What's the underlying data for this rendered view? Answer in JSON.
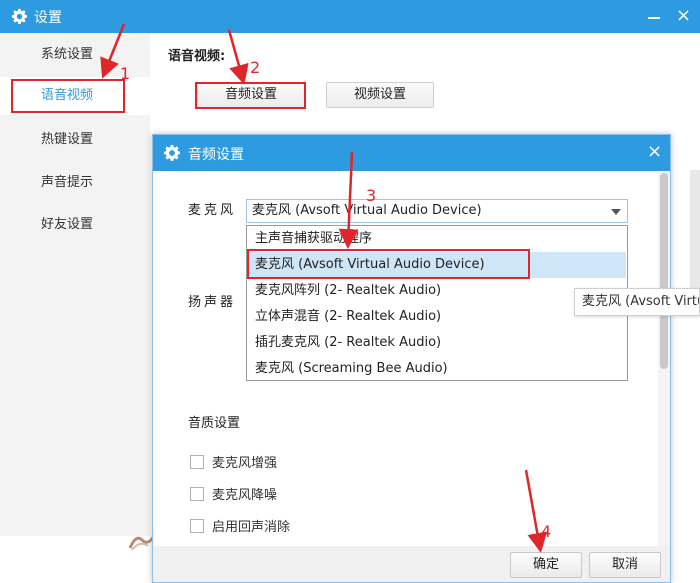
{
  "window": {
    "title": "设置",
    "close_glyph": "×"
  },
  "sidebar": {
    "items": [
      {
        "label": "系统设置"
      },
      {
        "label": "语音视频"
      },
      {
        "label": "热键设置"
      },
      {
        "label": "声音提示"
      },
      {
        "label": "好友设置"
      }
    ],
    "active_index": 1
  },
  "main": {
    "section_title": "语音视频:",
    "tabs": [
      {
        "label": "音频设置"
      },
      {
        "label": "视频设置"
      }
    ]
  },
  "dialog": {
    "title": "音频设置",
    "close_glyph": "×",
    "microphone_label": "麦克风",
    "speaker_label": "扬声器",
    "microphone_selected": "麦克风 (Avsoft Virtual Audio Device)",
    "microphone_options": [
      "主声音捕获驱动程序",
      "麦克风 (Avsoft Virtual Audio Device)",
      "麦克风阵列 (2- Realtek Audio)",
      "立体声混音 (2- Realtek Audio)",
      "插孔麦克风 (2- Realtek Audio)",
      "麦克风 (Screaming Bee Audio)"
    ],
    "hovered_option_index": 1,
    "quality_title": "音质设置",
    "quality_options": [
      {
        "label": "麦克风增强",
        "checked": false
      },
      {
        "label": "麦克风降噪",
        "checked": false
      },
      {
        "label": "启用回声消除",
        "checked": false
      }
    ],
    "ok_label": "确定",
    "cancel_label": "取消"
  },
  "tooltip": {
    "text": "麦克风 (Avsoft Virtual Audio Device)"
  },
  "annotations": {
    "steps": [
      "1",
      "2",
      "3",
      "4"
    ],
    "color": "#e0262a"
  },
  "colors": {
    "accent": "#2e9be0",
    "highlight": "#e0262a",
    "hover": "#cfe5f8"
  }
}
